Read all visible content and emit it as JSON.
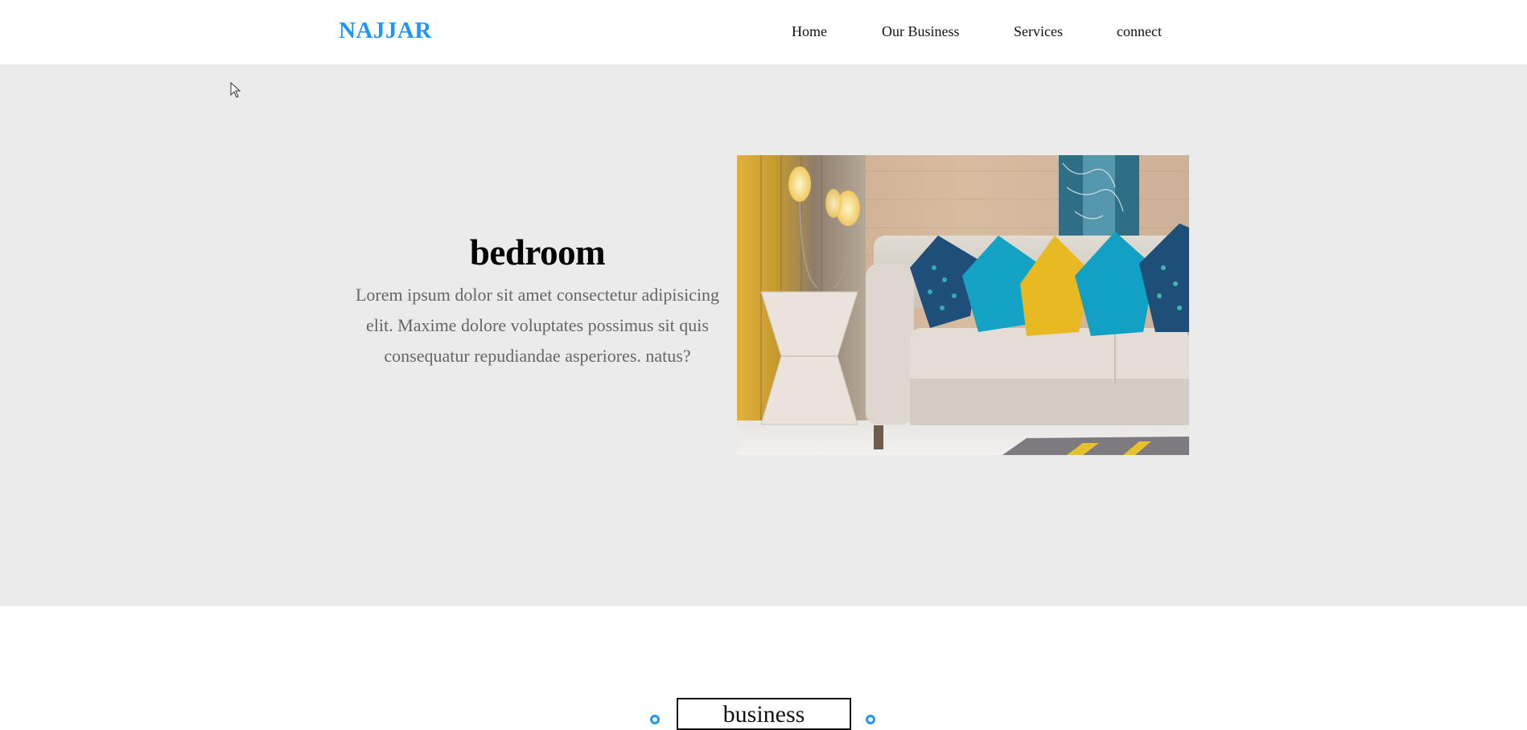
{
  "header": {
    "logo": "NAJJAR",
    "nav": [
      {
        "label": "Home"
      },
      {
        "label": "Our Business"
      },
      {
        "label": "Services"
      },
      {
        "label": "connect"
      }
    ]
  },
  "hero": {
    "title": "bedroom",
    "description": "Lorem ipsum dolor sit amet consectetur adipisicing elit. Maxime dolore voluptates possimus sit quis consequatur repudiandae asperiores. natus?",
    "image_icon": "living-room-sofa-image"
  },
  "section": {
    "title": "business"
  },
  "colors": {
    "brand": "#2196f3",
    "hero_bg": "#ebebeb",
    "text_muted": "#666666"
  }
}
